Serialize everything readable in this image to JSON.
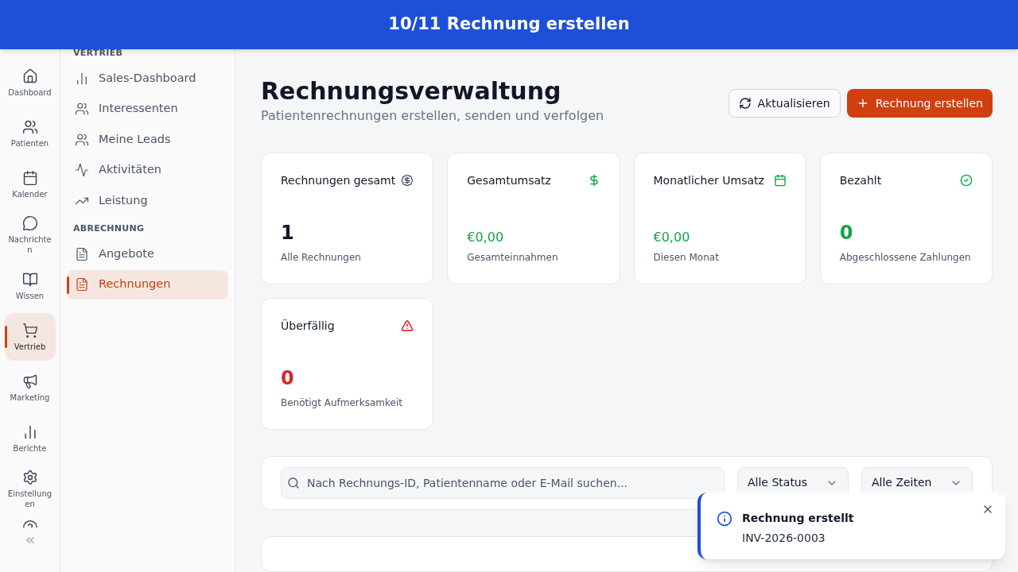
{
  "banner": {
    "title": "10/11 Rechnung erstellen"
  },
  "rail": {
    "items": [
      {
        "label": "Dashboard",
        "selected": false
      },
      {
        "label": "Patienten",
        "selected": false
      },
      {
        "label": "Kalender",
        "selected": false
      },
      {
        "label": "Nachrichten",
        "selected": false
      },
      {
        "label": "Wissen",
        "selected": false
      },
      {
        "label": "Vertrieb",
        "selected": true
      },
      {
        "label": "Marketing",
        "selected": false
      },
      {
        "label": "Berichte",
        "selected": false
      },
      {
        "label": "Einstellungen",
        "selected": false
      }
    ]
  },
  "sidebar": {
    "sections": [
      {
        "title": "VERTRIEB",
        "items": [
          {
            "label": "Sales-Dashboard",
            "selected": false
          },
          {
            "label": "Interessenten",
            "selected": false
          },
          {
            "label": "Meine Leads",
            "selected": false
          },
          {
            "label": "Aktivitäten",
            "selected": false
          },
          {
            "label": "Leistung",
            "selected": false
          }
        ]
      },
      {
        "title": "ABRECHNUNG",
        "items": [
          {
            "label": "Angebote",
            "selected": false
          },
          {
            "label": "Rechnungen",
            "selected": true
          }
        ]
      }
    ]
  },
  "header": {
    "title": "Rechnungsverwaltung",
    "subtitle": "Patientenrechnungen erstellen, senden und verfolgen",
    "buttons": [
      {
        "label": "Aktualisieren",
        "kind": "secondary"
      },
      {
        "label": "Rechnung erstellen",
        "kind": "primary"
      }
    ]
  },
  "stats": [
    {
      "title": "Rechnungen gesamt",
      "value": "1",
      "caption": "Alle Rechnungen",
      "color": "#111827",
      "kind": "count"
    },
    {
      "title": "Gesamtumsatz",
      "value": "€0,00",
      "caption": "Gesamteinnahmen",
      "color": "#16a34a",
      "kind": "amount"
    },
    {
      "title": "Monatlicher Umsatz",
      "value": "€0,00",
      "caption": "Diesen Monat",
      "color": "#16a34a",
      "kind": "amount"
    },
    {
      "title": "Bezahlt",
      "value": "0",
      "caption": "Abgeschlossene Zahlungen",
      "color": "#16a34a",
      "kind": "count"
    },
    {
      "title": "Überfällig",
      "value": "0",
      "caption": "Benötigt Aufmerksamkeit",
      "color": "#dc2626",
      "kind": "count"
    }
  ],
  "filters": {
    "search": {
      "placeholder": "Nach Rechnungs-ID, Patientenname oder E-Mail suchen..."
    },
    "selects": [
      "Alle Status",
      "Alle Zeiten"
    ]
  },
  "toast": {
    "title": "Rechnung erstellt",
    "message": "INV-2026-0003"
  }
}
